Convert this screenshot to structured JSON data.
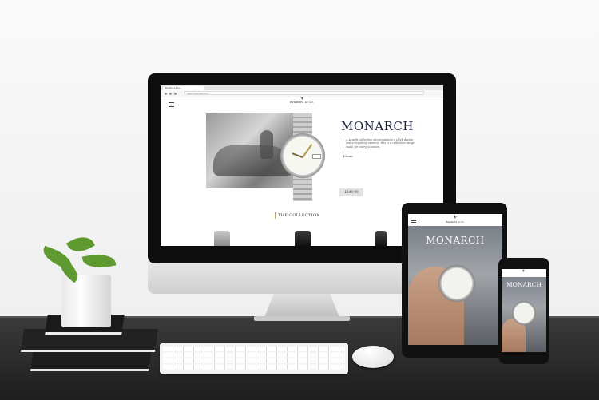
{
  "scene": {
    "devices": [
      "desktop",
      "tablet",
      "phone"
    ]
  },
  "desktop": {
    "browser": {
      "tab_title": "Bradford & Co.",
      "url": "https://example.com"
    },
    "site": {
      "brand": "Bradford & Co.",
      "hero_title": "MONARCH",
      "hero_description": "A superb collection encompassing a sleek design and a beguiling essence; this is a collection range made for every occasion.",
      "size_label": "40mm",
      "price": "£599.99",
      "section_heading": "THE COLLECTION"
    }
  },
  "tablet": {
    "brand": "Bradford & Co.",
    "hero_title": "MONARCH"
  },
  "phone": {
    "hero_title": "MONARCH"
  },
  "colors": {
    "title_navy": "#1c2240",
    "accent_gold": "#b9a36a",
    "desk": "#2a2a2a",
    "leaf_green": "#5f9a31"
  },
  "icons": [
    "hamburger-menu-icon",
    "brand-crest-icon"
  ]
}
